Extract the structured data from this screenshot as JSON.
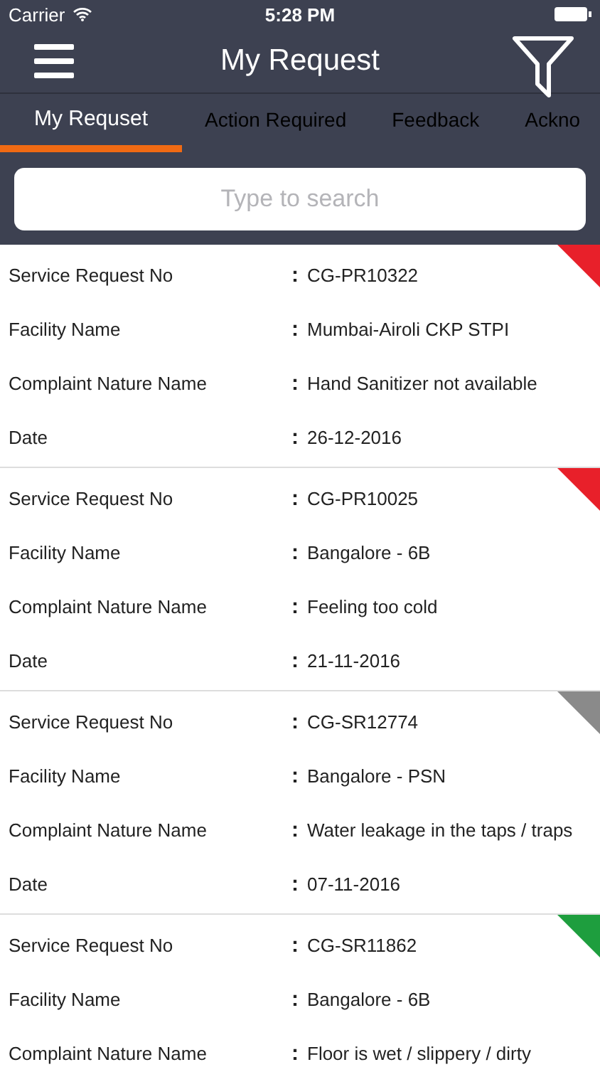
{
  "status_bar": {
    "carrier": "Carrier",
    "time": "5:28 PM"
  },
  "header": {
    "title": "My Request"
  },
  "tabs": [
    {
      "label": "My Requset",
      "selected": true
    },
    {
      "label": "Action Required",
      "selected": false
    },
    {
      "label": "Feedback",
      "selected": false
    },
    {
      "label": "Ackno",
      "selected": false
    }
  ],
  "search": {
    "placeholder": "Type to search"
  },
  "requests": [
    {
      "color": "#e8202a",
      "fields": [
        {
          "label": "Service Request No",
          "colon": ":",
          "value": "CG-PR10322"
        },
        {
          "label": "Facility Name",
          "colon": ":",
          "value": "Mumbai-Airoli CKP STPI"
        },
        {
          "label": "Complaint Nature Name",
          "colon": ":",
          "value": "Hand Sanitizer not available"
        },
        {
          "label": "Date",
          "colon": ":",
          "value": "26-12-2016"
        }
      ]
    },
    {
      "color": "#e8202a",
      "fields": [
        {
          "label": "Service Request No",
          "colon": ":",
          "value": "CG-PR10025"
        },
        {
          "label": "Facility Name",
          "colon": ":",
          "value": "Bangalore - 6B"
        },
        {
          "label": "Complaint Nature Name",
          "colon": ":",
          "value": "Feeling too cold"
        },
        {
          "label": "Date",
          "colon": ":",
          "value": "21-11-2016"
        }
      ]
    },
    {
      "color": "#8a8a8a",
      "fields": [
        {
          "label": "Service Request No",
          "colon": ":",
          "value": "CG-SR12774"
        },
        {
          "label": "Facility Name",
          "colon": ":",
          "value": "Bangalore - PSN"
        },
        {
          "label": "Complaint Nature Name",
          "colon": ":",
          "value": "Water leakage in the taps / traps"
        },
        {
          "label": "Date",
          "colon": ":",
          "value": "07-11-2016"
        }
      ]
    },
    {
      "color": "#1e9e3e",
      "fields": [
        {
          "label": "Service Request No",
          "colon": ":",
          "value": "CG-SR11862"
        },
        {
          "label": "Facility Name",
          "colon": ":",
          "value": "Bangalore - 6B"
        },
        {
          "label": "Complaint Nature Name",
          "colon": ":",
          "value": "Floor is wet / slippery / dirty"
        }
      ]
    }
  ]
}
